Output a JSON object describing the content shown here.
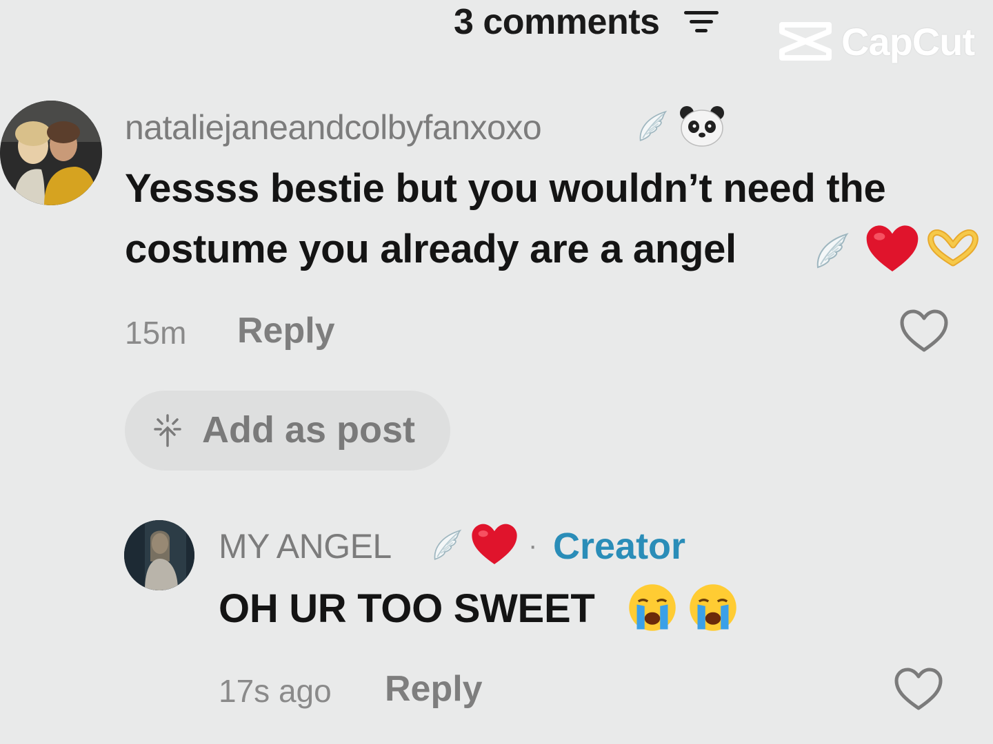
{
  "header": {
    "title": "3 comments",
    "filter_icon": "filter-lines-icon"
  },
  "watermark": {
    "text": "CapCut",
    "icon": "capcut-logo-icon"
  },
  "comments": [
    {
      "username": "nataliejaneandcolbyfanxoxo",
      "username_emojis": [
        "wing-emoji",
        "panda-emoji"
      ],
      "text_line1": "Yessss bestie but you wouldn’t need the",
      "text_line2": "costume you already are a angel",
      "text_emojis": [
        "wing-emoji",
        "red-heart-emoji",
        "heart-hands-emoji"
      ],
      "time": "15m",
      "reply_label": "Reply",
      "like_icon": "heart-outline-icon"
    },
    {
      "username": "MY ANGEL",
      "username_emojis": [
        "wing-emoji",
        "red-heart-emoji"
      ],
      "separator": "·",
      "badge": "Creator",
      "text": "OH UR TOO SWEET",
      "text_emojis": [
        "crying-face-emoji",
        "crying-face-emoji"
      ],
      "time": "17s ago",
      "reply_label": "Reply",
      "like_icon": "heart-outline-icon"
    }
  ],
  "add_as_post": {
    "label": "Add as post",
    "icon": "sparkle-arrow-icon"
  },
  "colors": {
    "background": "#e9eaea",
    "creator_badge": "#2a8db8",
    "heart_red": "#d8142a"
  }
}
